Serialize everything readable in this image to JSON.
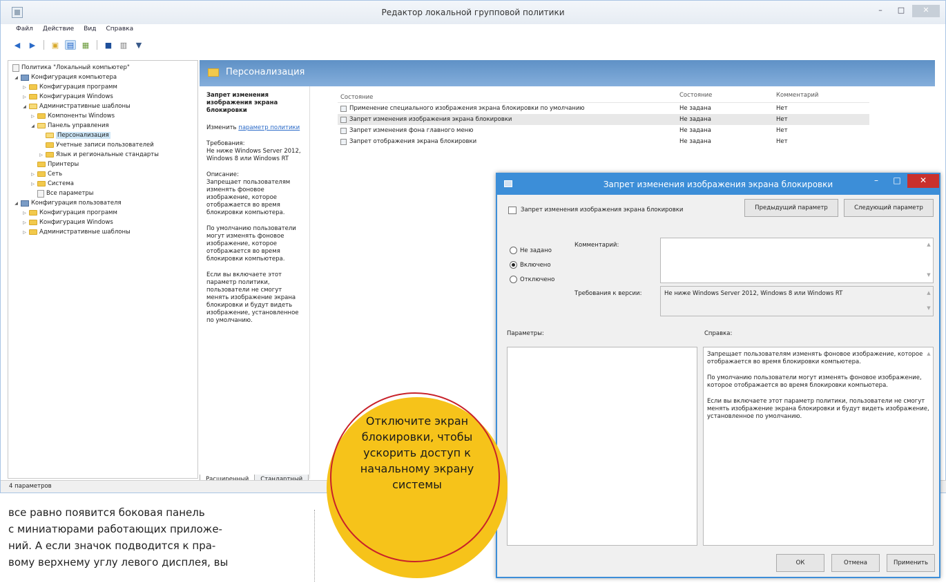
{
  "window": {
    "title": "Редактор локальной групповой политики",
    "minimize": "–",
    "maximize": "□",
    "close": "✕"
  },
  "menu": [
    "Файл",
    "Действие",
    "Вид",
    "Справка"
  ],
  "tree": {
    "root": "Политика \"Локальный компьютер\"",
    "computer_config": "Конфигурация компьютера",
    "software_config": "Конфигурация программ",
    "windows_config": "Конфигурация Windows",
    "admin_templates": "Административные шаблоны",
    "windows_components": "Компоненты Windows",
    "control_panel": "Панель управления",
    "personalization": "Персонализация",
    "user_accounts": "Учетные записи пользователей",
    "regional": "Язык и региональные стандарты",
    "printers": "Принтеры",
    "network": "Сеть",
    "system": "Система",
    "all_settings": "Все параметры",
    "user_config": "Конфигурация пользователя",
    "user_software_config": "Конфигурация программ",
    "user_windows_config": "Конфигурация Windows",
    "user_admin_templates": "Административные шаблоны"
  },
  "right": {
    "header": "Персонализация",
    "desc_title": "Запрет изменения изображения экрана блокировки",
    "edit_prefix": "Изменить",
    "edit_link": "параметр политики",
    "requirements": "Требования:\nНе ниже Windows Server 2012, Windows 8 или Windows RT",
    "description_label": "Описание:",
    "description_1": "Запрещает пользователям изменять фоновое изображение, которое отображается во время блокировки компьютера.",
    "description_2": "По умолчанию пользователи могут изменять фоновое изображение, которое отображается во время блокировки компьютера.",
    "description_3": "Если вы включаете этот параметр политики, пользователи не смогут менять изображение экрана блокировки и будут видеть изображение, установленное по умолчанию.",
    "tab_extended": "Расширенный",
    "tab_standard": "Стандартный",
    "columns": [
      "Состояние",
      "Состояние",
      "Комментарий"
    ],
    "rows": [
      {
        "name": "Применение специального изображения экрана блокировки по умолчанию",
        "state": "Не задана",
        "comment": "Нет"
      },
      {
        "name": "Запрет изменения изображения экрана блокировки",
        "state": "Не задана",
        "comment": "Нет"
      },
      {
        "name": "Запрет изменения фона главного меню",
        "state": "Не задана",
        "comment": "Нет"
      },
      {
        "name": "Запрет отображения экрана блокировки",
        "state": "Не задана",
        "comment": "Нет"
      }
    ]
  },
  "status": "4 параметров",
  "dialog": {
    "title": "Запрет изменения изображения экрана блокировки",
    "header_label": "Запрет изменения изображения экрана блокировки",
    "prev_button": "Предыдущий параметр",
    "next_button": "Следующий параметр",
    "radio_not_set": "Не задано",
    "radio_enabled": "Включено",
    "radio_disabled": "Отключено",
    "comment_label": "Комментарий:",
    "req_label": "Требования к версии:",
    "req_value": "Не ниже Windows Server 2012, Windows 8 или Windows RT",
    "params_label": "Параметры:",
    "help_label": "Справка:",
    "help_1": "Запрещает пользователям изменять фоновое изображение, которое отображается во время блокировки компьютера.",
    "help_2": "По умолчанию пользователи могут изменять фоновое изображение, которое отображается во время блокировки компьютера.",
    "help_3": "Если вы включаете этот параметр политики, пользователи не смогут менять изображение экрана блокировки и будут видеть изображение, установленное по умолчанию.",
    "ok": "ОК",
    "cancel": "Отмена",
    "apply": "Применить"
  },
  "article": [
    "все равно появится боковая панель",
    "с миниатюрами работающих приложе-",
    "ний. А если значок подводится к пра-",
    "вому верхнему углу левого дисплея, вы"
  ],
  "callout": "Отключите экран блокировки, чтобы ускорить доступ к начальному экрану системы"
}
